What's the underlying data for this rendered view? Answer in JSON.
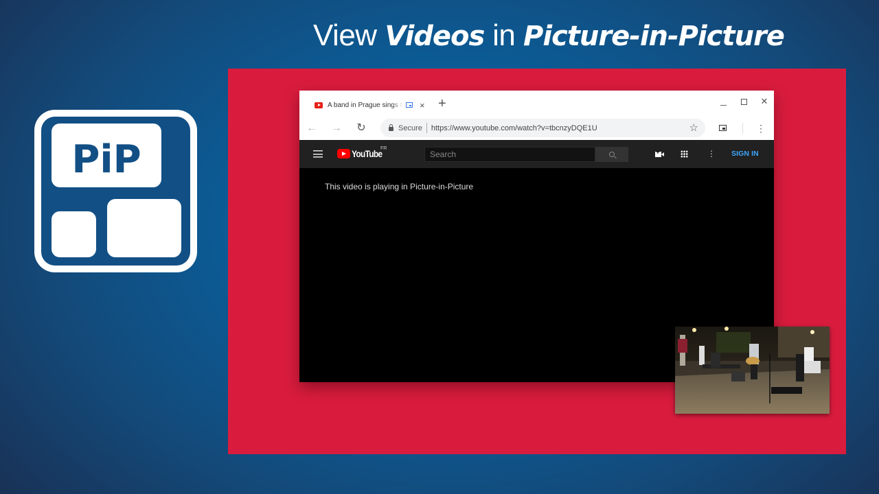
{
  "headline": {
    "word1": "View",
    "word2": "Videos",
    "word3": "in",
    "word4": "Picture-in-Picture"
  },
  "logo": {
    "text": "PiP",
    "color": "#124f85"
  },
  "colors": {
    "panel": "#d91c3e",
    "background_center": "#0d6aab",
    "background_edge": "#1a2d4f",
    "signin": "#3ea6ff"
  },
  "browser": {
    "tab": {
      "title": "A band in Prague sings the",
      "favicon": "youtube-icon",
      "pip_indicator": "picture-in-picture-icon",
      "close": "×"
    },
    "new_tab": "+",
    "window_controls": [
      "minimize",
      "maximize",
      "close"
    ],
    "close_glyph": "✕",
    "toolbar": {
      "back": "←",
      "forward": "→",
      "reload": "↻",
      "secure_label": "Secure",
      "url": "https://www.youtube.com/watch?v=tbcnzyDQE1U",
      "star": "☆",
      "menu": "⋮"
    }
  },
  "youtube": {
    "logo_text": "YouTube",
    "region": "FR",
    "search_placeholder": "Search",
    "more": "⋮",
    "sign_in": "SIGN IN",
    "pip_message": "This video is playing in Picture-in-Picture"
  },
  "pip_video": {
    "description": "Street band performing at night in Prague"
  }
}
